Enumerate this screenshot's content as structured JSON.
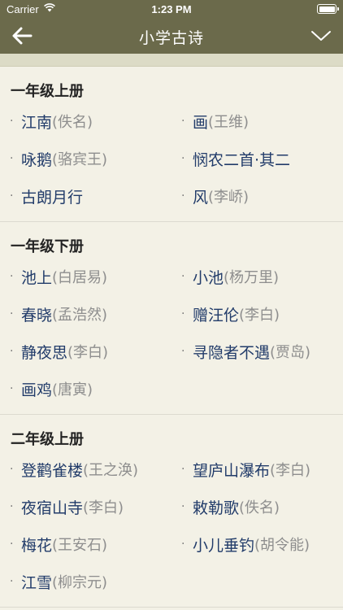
{
  "status": {
    "carrier": "Carrier",
    "time": "1:23 PM"
  },
  "nav": {
    "title": "小学古诗"
  },
  "sections": [
    {
      "title": "一年级上册",
      "poems": [
        {
          "title": "江南",
          "author": "(佚名)"
        },
        {
          "title": "画",
          "author": "(王维)"
        },
        {
          "title": "咏鹅",
          "author": "(骆宾王)"
        },
        {
          "title": "悯农二首·其二",
          "author": ""
        },
        {
          "title": "古朗月行",
          "author": ""
        },
        {
          "title": "风",
          "author": "(李峤)"
        }
      ]
    },
    {
      "title": "一年级下册",
      "poems": [
        {
          "title": "池上",
          "author": "(白居易)"
        },
        {
          "title": "小池",
          "author": "(杨万里)"
        },
        {
          "title": "春晓",
          "author": "(孟浩然)"
        },
        {
          "title": "赠汪伦",
          "author": "(李白)"
        },
        {
          "title": "静夜思",
          "author": "(李白)"
        },
        {
          "title": "寻隐者不遇",
          "author": "(贾岛)"
        },
        {
          "title": "画鸡",
          "author": "(唐寅)"
        }
      ]
    },
    {
      "title": "二年级上册",
      "poems": [
        {
          "title": "登鹳雀楼",
          "author": "(王之涣)"
        },
        {
          "title": "望庐山瀑布",
          "author": "(李白)"
        },
        {
          "title": "夜宿山寺",
          "author": "(李白)"
        },
        {
          "title": "敕勒歌",
          "author": "(佚名)"
        },
        {
          "title": "梅花",
          "author": "(王安石)"
        },
        {
          "title": "小儿垂钓",
          "author": "(胡令能)"
        },
        {
          "title": "江雪",
          "author": "(柳宗元)"
        }
      ]
    }
  ]
}
